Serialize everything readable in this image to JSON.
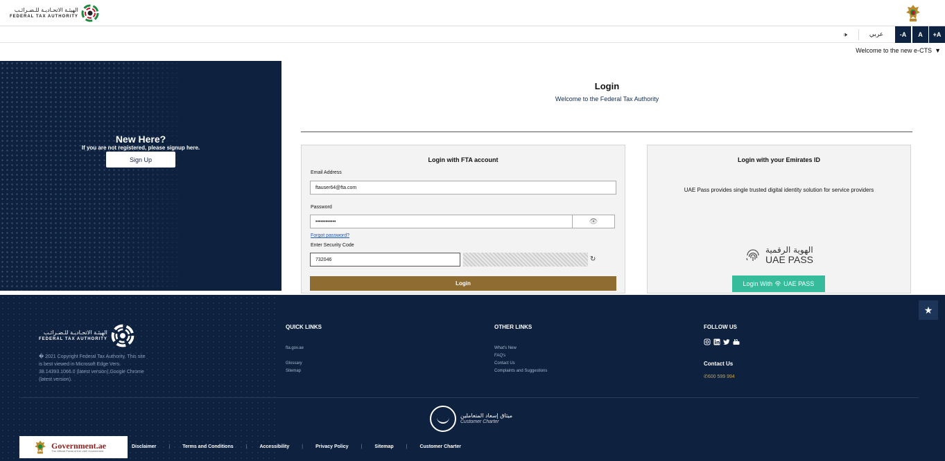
{
  "header": {
    "logo_ar": "الهيئـة الاتحـاديـة للـضـرائـب",
    "logo_en": "FEDERAL TAX AUTHORITY",
    "emblem_icon": "uae-emblem-icon"
  },
  "toolbar": {
    "speaker_icon": "speaker-icon",
    "speaker_glyph": "🕩",
    "arabic_label": "عربي",
    "font_decrease": "-A",
    "font_normal": "A",
    "font_increase": "+A",
    "welcome_text": "Welcome to the new e-CTS",
    "welcome_caret": "▼"
  },
  "left_panel": {
    "title": "New Here?",
    "subtitle": "If you are not registered, please signup here.",
    "signup_label": "Sign Up"
  },
  "login": {
    "title": "Login",
    "subtitle": "Welcome to the Federal Tax Authority",
    "fta_card": {
      "title": "Login with FTA account",
      "email_label": "Email Address",
      "email_value": "ftauser64@fta.com",
      "password_label": "Password",
      "password_value": "••••••••••••",
      "eye_glyph": "👁",
      "forgot_label": "Forgot password?",
      "security_label": "Enter Security Code",
      "security_value": "732046",
      "refresh_glyph": "↻",
      "login_label": "Login"
    },
    "eid_card": {
      "title": "Login with your Emirates ID",
      "description": "UAE Pass provides single trusted digital identity solution for service providers",
      "uaepass_ar": "الهوية الرقمية",
      "uaepass_en": "UAE PASS",
      "button_label": "Login With",
      "button_brand": "UAE PASS"
    }
  },
  "footer": {
    "logo_ar": "الهيئـة الاتحـاديـة للـضـرائـب",
    "logo_en": "FEDERAL TAX AUTHORITY",
    "copyright": "� 2021 Copyright Federal Tax Authority. This site is best viewed in Microsoft Edge Vers. 38.14393.1066.0 (latest version),Google Chrome (latest version).",
    "quick_links": {
      "heading": "QUICK LINKS",
      "items": [
        "fta.gov.ae",
        "Glossary",
        "Sitemap"
      ]
    },
    "other_links": {
      "heading": "OTHER LINKS",
      "items": [
        "What's New",
        "FAQ's",
        "Contact Us",
        "Complaints and Suggestions"
      ]
    },
    "follow": {
      "heading": "FOLLOW US",
      "icons": [
        "instagram-icon",
        "linkedin-icon",
        "twitter-icon",
        "youtube-icon"
      ]
    },
    "contact": {
      "heading": "Contact Us",
      "phone": "✆600 599 994"
    },
    "charter": {
      "ar": "ميثاق إسعاد المتعاملين",
      "en": "Customer Charter"
    },
    "gov": {
      "title": "Government.ae",
      "subtitle": "The Official Portal of the UAE Government"
    },
    "bottom_links": [
      "Disclaimer",
      "Terms and Conditions",
      "Accessibility",
      "Privacy Policy",
      "Sitemap",
      "Customer Charter"
    ],
    "bottom_sep": "|",
    "star_glyph": "★"
  }
}
